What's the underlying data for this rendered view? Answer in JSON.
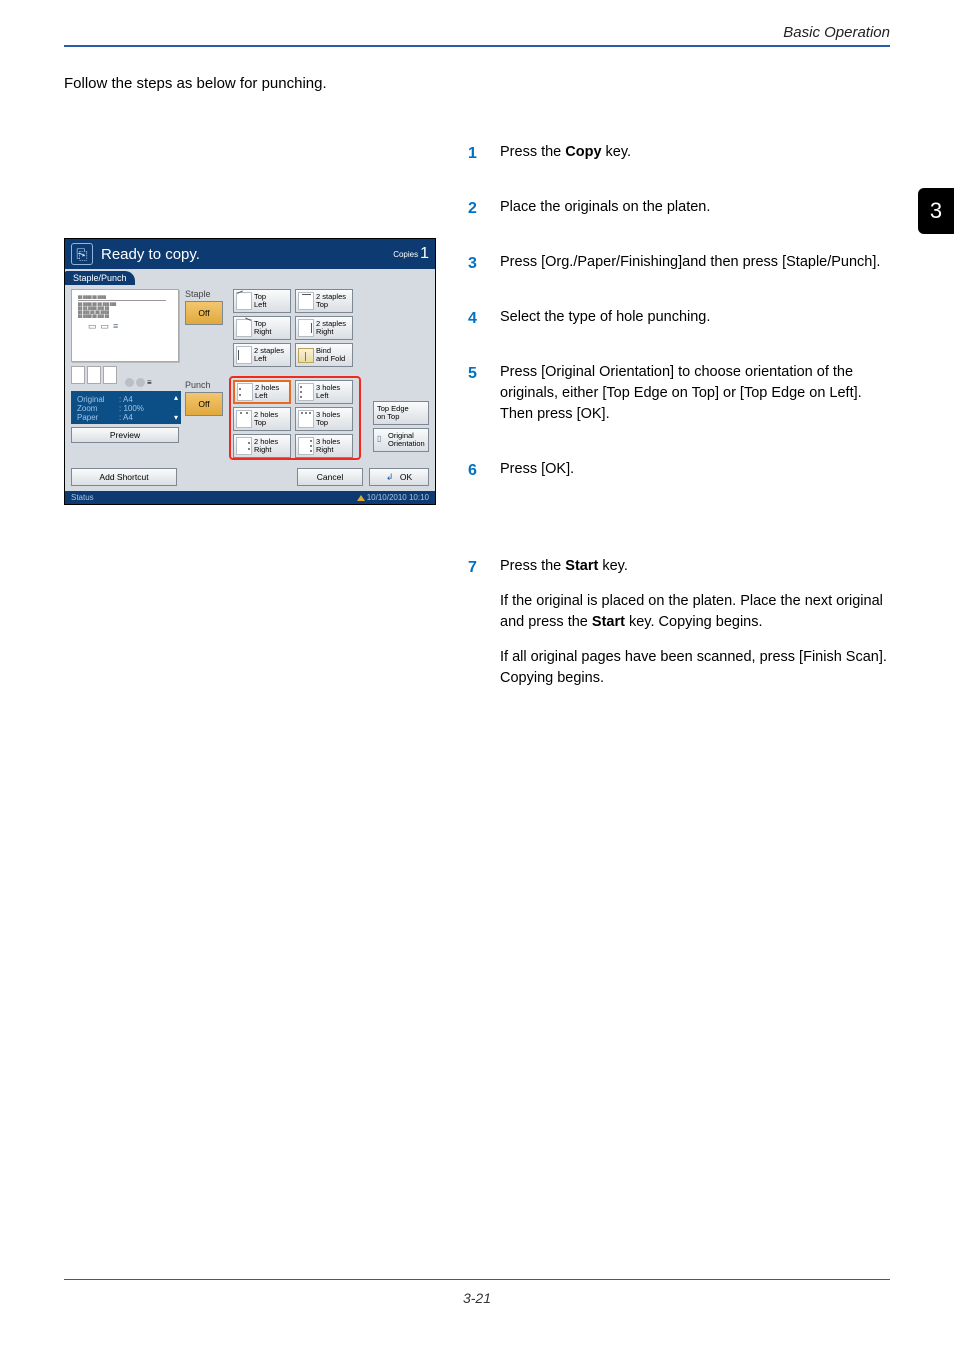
{
  "header": {
    "section": "Basic Operation"
  },
  "side_tab": "3",
  "intro": "Follow the steps as below for punching.",
  "footer": "3-21",
  "steps": [
    {
      "n": "1",
      "body": "Press the <b>Copy</b> key."
    },
    {
      "n": "2",
      "body": "Place the originals on the platen."
    },
    {
      "n": "3",
      "body": "Press [Org./Paper/Finishing]and then press [Staple/Punch]."
    },
    {
      "n": "4",
      "body": "Select the type of hole punching."
    },
    {
      "n": "5",
      "body": "Press [Original Orientation] to choose orientation of the originals, either [Top Edge on Top] or [Top Edge on Left]. Then press [OK]."
    },
    {
      "n": "6",
      "body": "Press [OK]."
    },
    {
      "n": "7",
      "body": "Press the <b>Start</b> key.",
      "follow": [
        "If the original is placed on the platen. Place the next original and press the <b>Start</b> key. Copying begins.",
        "If all original pages have been scanned, press [Finish Scan]. Copying begins."
      ]
    }
  ],
  "panel": {
    "title": "Ready to copy.",
    "copies_label": "Copies",
    "copies_value": "1",
    "tab": "Staple/Punch",
    "preview": {
      "original_label": "Original",
      "original_value": ": A4",
      "zoom_label": "Zoom",
      "zoom_value": ": 100%",
      "paper_label": "Paper",
      "paper_value": ": A4",
      "btn": "Preview"
    },
    "staple_label": "Staple",
    "staple_off": "Off",
    "punch_label": "Punch",
    "punch_off": "Off",
    "opts": {
      "top_left": "Top\nLeft",
      "top_right": "Top\nRight",
      "two_staples_left": "2 staples\nLeft",
      "two_staples_top": "2 staples\nTop",
      "two_staples_right": "2 staples\nRight",
      "bind_fold": "Bind\nand Fold",
      "two_holes_left": "2 holes\nLeft",
      "three_holes_left": "3 holes\nLeft",
      "two_holes_top": "2 holes\nTop",
      "three_holes_top": "3 holes\nTop",
      "two_holes_right": "2 holes\nRight",
      "three_holes_right": "3 holes\nRight"
    },
    "right": {
      "top_edge": "Top Edge\non Top",
      "orientation": "Original\nOrientation"
    },
    "bottom": {
      "shortcut": "Add Shortcut",
      "cancel": "Cancel",
      "ok": "OK"
    },
    "status": {
      "label": "Status",
      "time": "10/10/2010 10:10"
    }
  }
}
